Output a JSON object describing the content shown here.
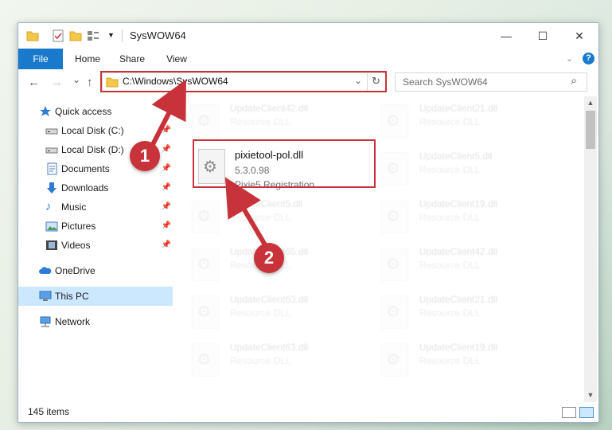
{
  "window": {
    "title": "SysWOW64",
    "controls": {
      "minimize": "—",
      "maximize": "☐",
      "close": "✕"
    }
  },
  "ribbon": {
    "tabs": [
      {
        "label": "File",
        "active": true
      },
      {
        "label": "Home"
      },
      {
        "label": "Share"
      },
      {
        "label": "View"
      }
    ],
    "expand_icon": "chevron-down-icon",
    "help_icon": "help-icon",
    "help_label": "?"
  },
  "nav": {
    "address_path": "C:\\Windows\\SysWOW64",
    "search_placeholder": "Search SysWOW64",
    "back_label": "←",
    "forward_label": "→",
    "up_label": "↑",
    "recent_label": "⌄",
    "refresh_label": "↻",
    "dropdown_label": "⌄",
    "search_icon_label": "⌕"
  },
  "sidebar": {
    "items": [
      {
        "label": "Quick access",
        "icon": "star-icon",
        "pinned": false
      },
      {
        "label": "Local Disk (C:)",
        "icon": "drive-icon",
        "pinned": true
      },
      {
        "label": "Local Disk (D:)",
        "icon": "drive-icon",
        "pinned": true
      },
      {
        "label": "Documents",
        "icon": "documents-icon",
        "pinned": true
      },
      {
        "label": "Downloads",
        "icon": "download-icon",
        "pinned": true
      },
      {
        "label": "Music",
        "icon": "music-icon",
        "pinned": true
      },
      {
        "label": "Pictures",
        "icon": "pictures-icon",
        "pinned": true
      },
      {
        "label": "Videos",
        "icon": "videos-icon",
        "pinned": true
      },
      {
        "label": "OneDrive",
        "icon": "cloud-icon",
        "pinned": false
      },
      {
        "label": "This PC",
        "icon": "computer-icon",
        "pinned": false,
        "selected": true
      },
      {
        "label": "Network",
        "icon": "network-icon",
        "pinned": false
      }
    ]
  },
  "files": [
    {
      "name": "UpdateClient42.dll",
      "line2": "Resource DLL",
      "faded": true
    },
    {
      "name": "UpdateClient21.dll",
      "line2": "Resource DLL",
      "faded": true
    },
    {
      "name": "pixietool-pol.dll",
      "line2": "5.3.0.98",
      "line3": "Pixie5 Registration...",
      "faded": false,
      "highlighted": true
    },
    {
      "name": "UpdateClient5.dll",
      "line2": "Resource DLL",
      "faded": true
    },
    {
      "name": "UpdateClient5.dll",
      "line2": "Resource DLL",
      "faded": true
    },
    {
      "name": "UpdateClient19.dll",
      "line2": "Resource DLL",
      "faded": true
    },
    {
      "name": "UpdateClient65.dll",
      "line2": "Resource DLL",
      "faded": true
    },
    {
      "name": "UpdateClient42.dll",
      "line2": "Resource DLL",
      "faded": true
    },
    {
      "name": "UpdateClient63.dll",
      "line2": "Resource DLL",
      "faded": true
    },
    {
      "name": "UpdateClient21.dll",
      "line2": "Resource DLL",
      "faded": true
    },
    {
      "name": "UpdateClient63.dll",
      "line2": "Resource DLL",
      "faded": true
    },
    {
      "name": "UpdateClient19.dll",
      "line2": "Resource DLL",
      "faded": true
    }
  ],
  "status": {
    "item_count": "145 items"
  },
  "callouts": [
    {
      "label": "1"
    },
    {
      "label": "2"
    }
  ],
  "colors": {
    "accent": "#1979ca",
    "callout": "#c8323a",
    "selected": "#cce8ff"
  }
}
